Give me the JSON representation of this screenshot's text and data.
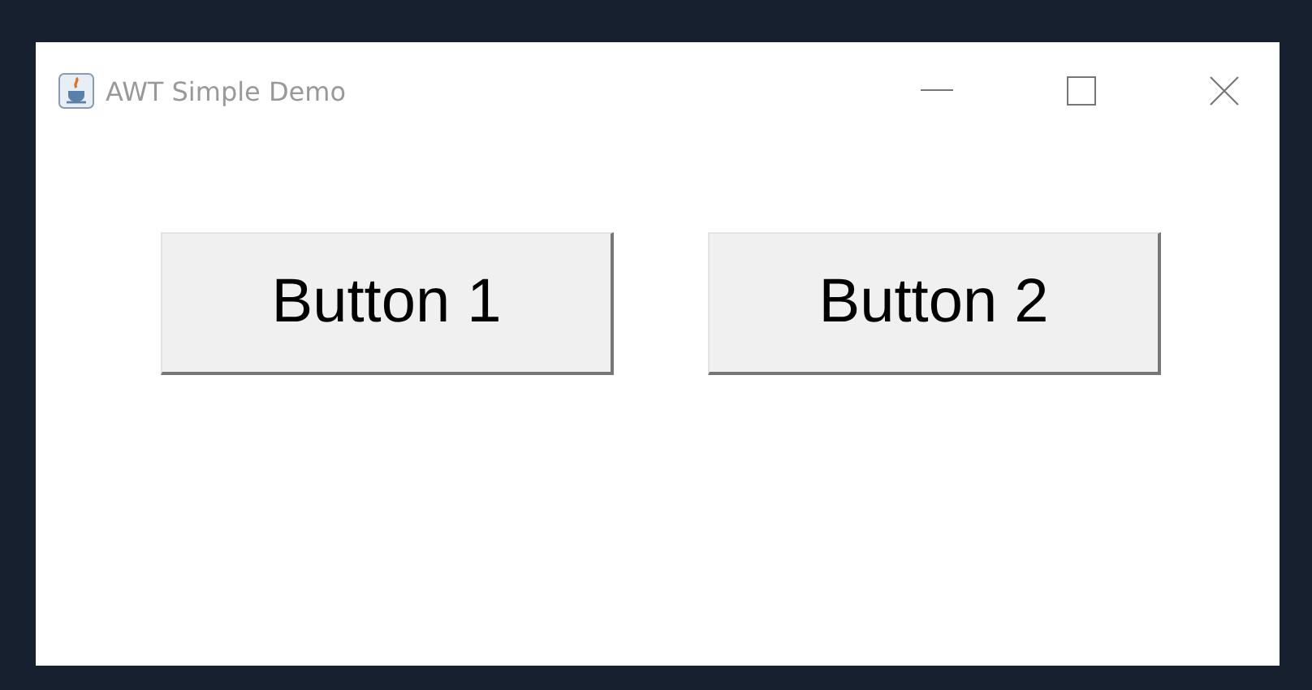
{
  "window": {
    "title": "AWT Simple Demo"
  },
  "buttons": [
    "Button 1",
    "Button 2"
  ]
}
